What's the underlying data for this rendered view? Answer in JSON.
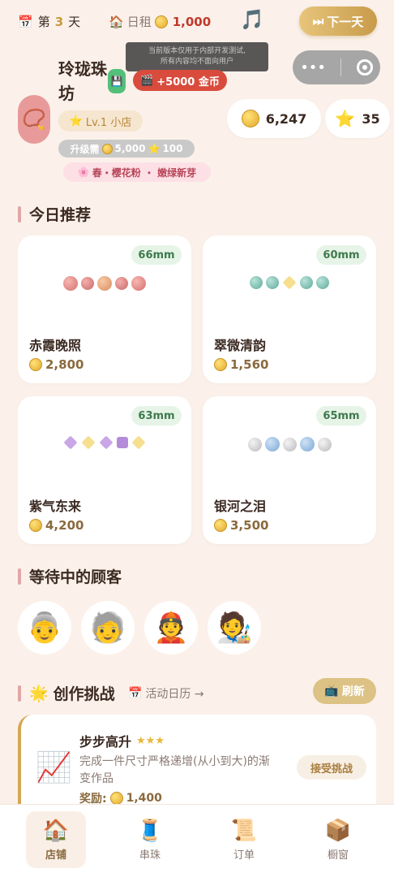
{
  "header": {
    "day_prefix": "第",
    "day_number": "3",
    "day_suffix": "天",
    "rent_label": "日租",
    "rent_value": "1,000",
    "next_day_label": "下一天"
  },
  "shop": {
    "name": "玲珑珠坊",
    "tooltip_line1": "当前版本仅用于内部开发测试,",
    "tooltip_line2": "所有内容均不面向用户",
    "reward_label": "+5000 金币",
    "level": "Lv.1 小店",
    "upgrade_prefix": "升级需",
    "upgrade_coins": "5,000",
    "upgrade_stars": "100",
    "season": "春・樱花粉 ・ 嫩绿新芽",
    "coins": "6,247",
    "stars": "35"
  },
  "sections": {
    "recommend": "今日推荐",
    "customers": "等待中的顾客",
    "challenge": "创作挑战",
    "calendar": "活动日历 →",
    "refresh": "刷新"
  },
  "products": [
    {
      "name": "赤霞晚照",
      "price": "2,800",
      "size": "66mm"
    },
    {
      "name": "翠微清韵",
      "price": "1,560",
      "size": "60mm"
    },
    {
      "name": "紫气东来",
      "price": "4,200",
      "size": "63mm"
    },
    {
      "name": "银河之泪",
      "price": "3,500",
      "size": "65mm"
    }
  ],
  "customers": [
    "older-woman",
    "older-person",
    "princess",
    "artist"
  ],
  "challenge": {
    "name": "步步高升",
    "stars": "★★★",
    "description": "完成一件尺寸严格递增(从小到大)的渐变作品",
    "reward_label": "奖励:",
    "reward_value": "1,400",
    "accept_label": "接受挑战"
  },
  "nav": [
    {
      "label": "店铺",
      "icon": "house-icon"
    },
    {
      "label": "串珠",
      "icon": "thread-icon"
    },
    {
      "label": "订单",
      "icon": "scroll-icon"
    },
    {
      "label": "橱窗",
      "icon": "package-icon"
    }
  ],
  "colors": {
    "accent_gold": "#c89b4a",
    "rent_red": "#c0392b",
    "reward_red": "#d94b3c",
    "size_tag_green": "#e6f4e7"
  }
}
